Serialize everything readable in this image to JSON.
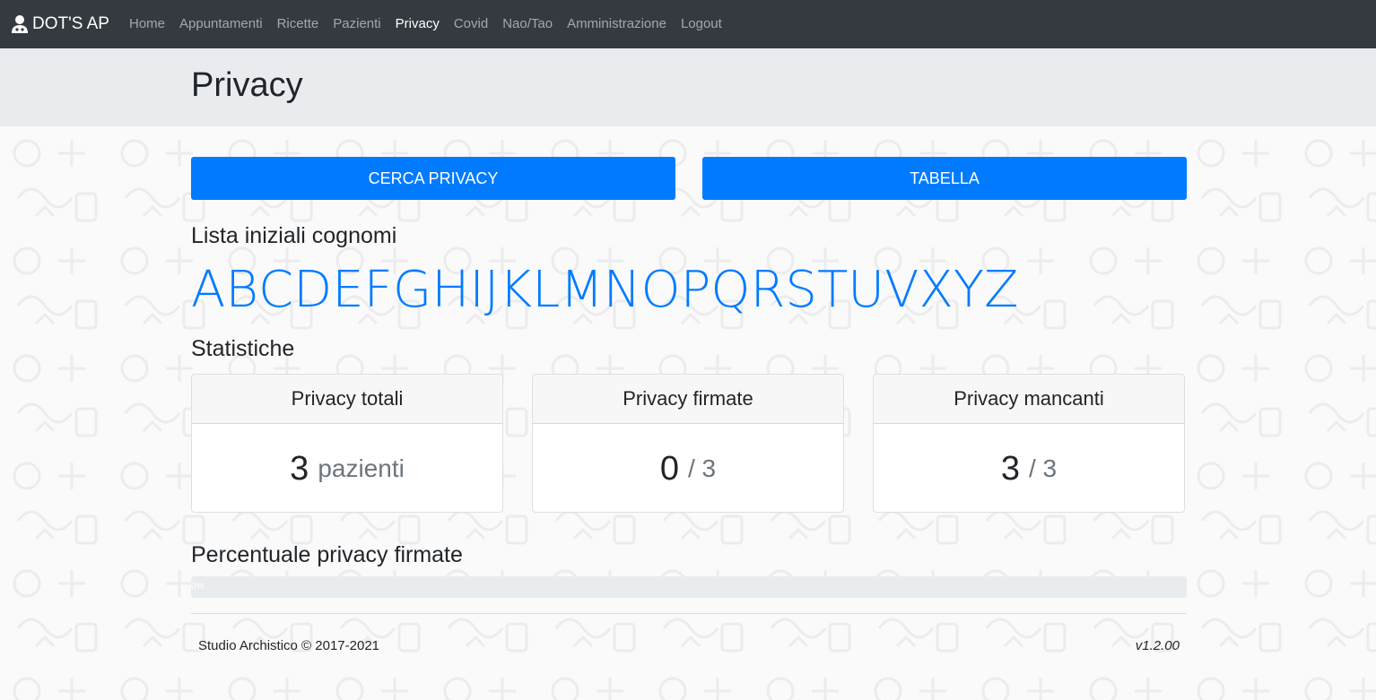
{
  "nav": {
    "brand": "DOT'S AP",
    "brand_icon": "doctor-icon",
    "items": [
      {
        "label": "Home",
        "active": false
      },
      {
        "label": "Appuntamenti",
        "active": false
      },
      {
        "label": "Ricette",
        "active": false
      },
      {
        "label": "Pazienti",
        "active": false
      },
      {
        "label": "Privacy",
        "active": true
      },
      {
        "label": "Covid",
        "active": false
      },
      {
        "label": "Nao/Tao",
        "active": false
      },
      {
        "label": "Amministrazione",
        "active": false
      },
      {
        "label": "Logout",
        "active": false
      }
    ]
  },
  "page": {
    "title": "Privacy"
  },
  "buttons": {
    "search": "CERCA PRIVACY",
    "table": "TABELLA"
  },
  "initials": {
    "heading": "Lista iniziali cognomi",
    "letters": [
      "A",
      "B",
      "C",
      "D",
      "E",
      "F",
      "G",
      "H",
      "I",
      "J",
      "K",
      "L",
      "M",
      "N",
      "O",
      "P",
      "Q",
      "R",
      "S",
      "T",
      "U",
      "V",
      "X",
      "Y",
      "Z"
    ]
  },
  "stats": {
    "heading": "Statistiche",
    "cards": [
      {
        "title": "Privacy totali",
        "value": "3",
        "suffix": "pazienti"
      },
      {
        "title": "Privacy firmate",
        "value": "0",
        "suffix": "/ 3"
      },
      {
        "title": "Privacy mancanti",
        "value": "3",
        "suffix": "/ 3"
      }
    ]
  },
  "progress": {
    "heading": "Percentuale privacy firmate",
    "label": "0%",
    "percent": 0
  },
  "footer": {
    "copyright": "Studio Archistico © 2017-2021",
    "version": "v1.2.00"
  },
  "colors": {
    "primary": "#007bff",
    "navbar": "#343a40",
    "jumbotron": "#e9ecef"
  }
}
